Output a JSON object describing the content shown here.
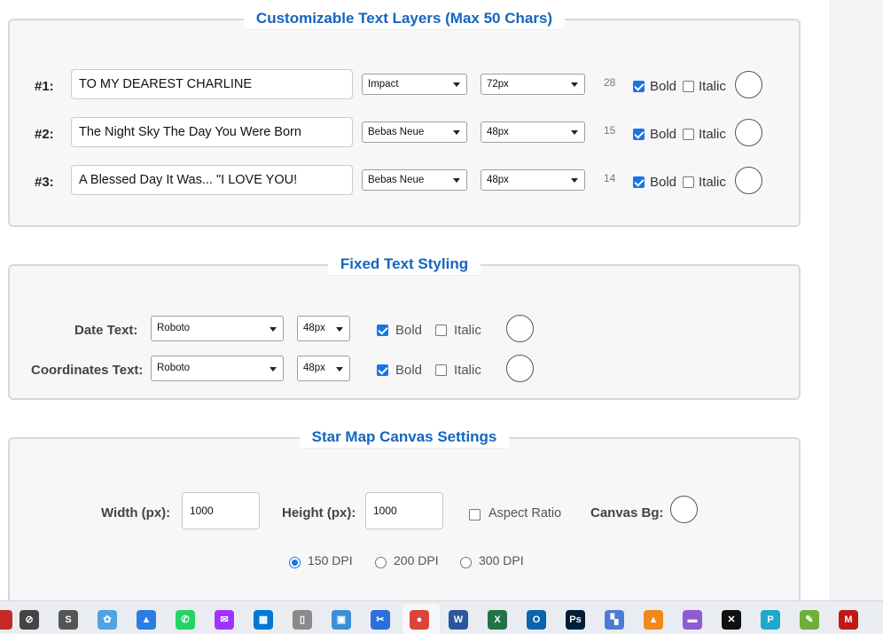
{
  "text_layers": {
    "title": "Customizable Text Layers (Max 50 Chars)",
    "rows": [
      {
        "label": "#1:",
        "value": "TO MY DEAREST CHARLINE",
        "font": "Impact",
        "size": "72px",
        "count": "28",
        "bold_label": "Bold",
        "bold": true,
        "italic_label": "Italic",
        "italic": false
      },
      {
        "label": "#2:",
        "value": "The Night Sky The Day You Were Born",
        "font": "Bebas Neue",
        "size": "48px",
        "count": "15",
        "bold_label": "Bold",
        "bold": true,
        "italic_label": "Italic",
        "italic": false
      },
      {
        "label": "#3:",
        "value": "A Blessed Day It Was... \"I LOVE YOU!",
        "font": "Bebas Neue",
        "size": "48px",
        "count": "14",
        "bold_label": "Bold",
        "bold": true,
        "italic_label": "Italic",
        "italic": false
      }
    ]
  },
  "fixed_styling": {
    "title": "Fixed Text Styling",
    "rows": [
      {
        "label": "Date Text:",
        "font": "Roboto",
        "size": "48px",
        "bold_label": "Bold",
        "bold": true,
        "italic_label": "Italic",
        "italic": false
      },
      {
        "label": "Coordinates Text:",
        "font": "Roboto",
        "size": "48px",
        "bold_label": "Bold",
        "bold": true,
        "italic_label": "Italic",
        "italic": false
      }
    ]
  },
  "canvas": {
    "title": "Star Map Canvas Settings",
    "width_label": "Width (px):",
    "width_value": "1000",
    "height_label": "Height (px):",
    "height_value": "1000",
    "aspect_label": "Aspect Ratio",
    "aspect_checked": false,
    "bg_label": "Canvas Bg:",
    "dpi_options": [
      {
        "label": "150 DPI",
        "selected": true
      },
      {
        "label": "200 DPI",
        "selected": false
      },
      {
        "label": "300 DPI",
        "selected": false
      }
    ]
  },
  "taskbar": {
    "apps": [
      {
        "name": "power-icon",
        "color": "#c62828",
        "glyph": ""
      },
      {
        "name": "blocked-icon",
        "color": "#444444",
        "glyph": "⊘"
      },
      {
        "name": "s-app-icon",
        "color": "#555555",
        "glyph": "S"
      },
      {
        "name": "palette-icon",
        "color": "#4fa3e0",
        "glyph": "✿"
      },
      {
        "name": "photos-icon",
        "color": "#2a7de1",
        "glyph": "▲"
      },
      {
        "name": "whatsapp-icon",
        "color": "#25d366",
        "glyph": "✆"
      },
      {
        "name": "messenger-icon",
        "color": "#a033ff",
        "glyph": "✉"
      },
      {
        "name": "store-icon",
        "color": "#0078d4",
        "glyph": "▦"
      },
      {
        "name": "book-icon",
        "color": "#8a8a8a",
        "glyph": "▯"
      },
      {
        "name": "control-panel-icon",
        "color": "#3a8fd6",
        "glyph": "▣"
      },
      {
        "name": "snipping-icon",
        "color": "#2a6fdb",
        "glyph": "✂"
      },
      {
        "name": "chrome-icon",
        "color": "#db4437",
        "glyph": "●"
      },
      {
        "name": "word-icon",
        "color": "#2b579a",
        "glyph": "W"
      },
      {
        "name": "excel-icon",
        "color": "#217346",
        "glyph": "X"
      },
      {
        "name": "outlook-icon",
        "color": "#0a64ad",
        "glyph": "O"
      },
      {
        "name": "photoshop-icon",
        "color": "#001e36",
        "glyph": "Ps"
      },
      {
        "name": "app-grid-icon",
        "color": "#4b7bd6",
        "glyph": "▚"
      },
      {
        "name": "vlc-icon",
        "color": "#ee8a1b",
        "glyph": "▲"
      },
      {
        "name": "clapper-icon",
        "color": "#8e5bd6",
        "glyph": "▬"
      },
      {
        "name": "capcut-icon",
        "color": "#111111",
        "glyph": "✕"
      },
      {
        "name": "p-cloud-icon",
        "color": "#1fa9c9",
        "glyph": "P"
      },
      {
        "name": "notepad-icon",
        "color": "#6fae3b",
        "glyph": "✎"
      },
      {
        "name": "mcafee-icon",
        "color": "#c01818",
        "glyph": "M"
      }
    ]
  }
}
